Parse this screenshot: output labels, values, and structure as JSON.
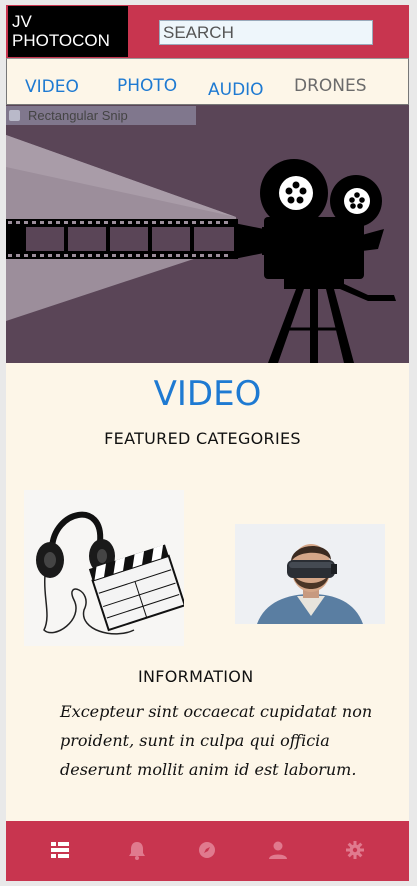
{
  "header": {
    "logo_text": "JV PHOTOCON",
    "search_placeholder": "SEARCH"
  },
  "nav": {
    "items": [
      {
        "label": "VIDEO",
        "color": "#1e7ad2"
      },
      {
        "label": "PHOTO",
        "color": "#1e7ad2"
      },
      {
        "label": "AUDIO",
        "color": "#1e7ad2"
      },
      {
        "label": "DRONES",
        "color": "#6b6b6b"
      }
    ]
  },
  "overlay": {
    "snip_label": "Rectangular Snip"
  },
  "hero": {
    "icon": "film-camera-projector-icon",
    "bg_color": "#5a4557"
  },
  "main": {
    "title": "VIDEO",
    "subtitle": "FEATURED CATEGORIES"
  },
  "categories": [
    {
      "icon": "headphones-clapperboard-image"
    },
    {
      "icon": "vr-headset-person-image"
    }
  ],
  "info": {
    "title": "INFORMATION",
    "text": "Excepteur sint occaecat cupidatat non proident, sunt in culpa qui officia deserunt mollit anim id est laborum."
  },
  "bottom_nav": {
    "items": [
      {
        "icon": "list-icon",
        "active": true
      },
      {
        "icon": "bell-icon",
        "active": false
      },
      {
        "icon": "compass-icon",
        "active": false
      },
      {
        "icon": "user-icon",
        "active": false
      },
      {
        "icon": "gear-icon",
        "active": false
      }
    ],
    "accent": "#c8354f"
  }
}
